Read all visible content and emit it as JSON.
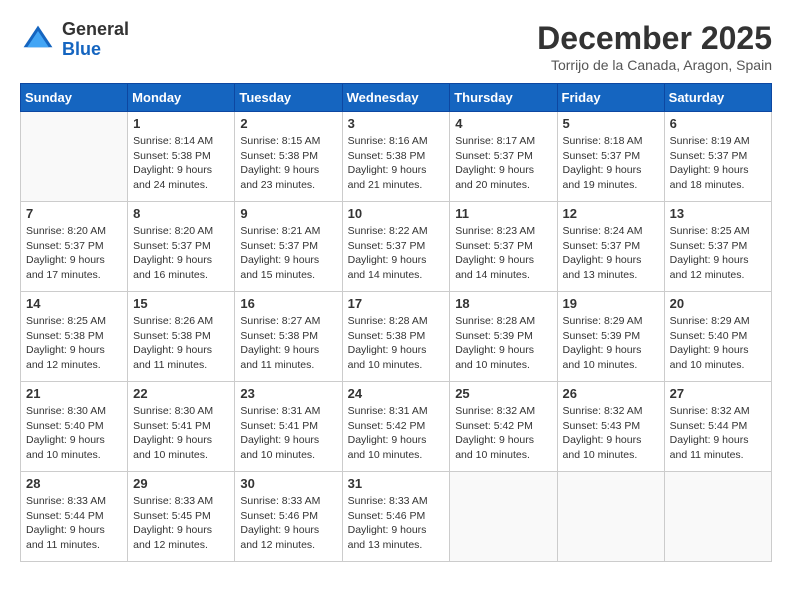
{
  "header": {
    "logo": {
      "general": "General",
      "blue": "Blue"
    },
    "title": "December 2025",
    "location": "Torrijo de la Canada, Aragon, Spain"
  },
  "weekdays": [
    "Sunday",
    "Monday",
    "Tuesday",
    "Wednesday",
    "Thursday",
    "Friday",
    "Saturday"
  ],
  "weeks": [
    [
      {
        "day": "",
        "sunrise": "",
        "sunset": "",
        "daylight": ""
      },
      {
        "day": "1",
        "sunrise": "Sunrise: 8:14 AM",
        "sunset": "Sunset: 5:38 PM",
        "daylight": "Daylight: 9 hours and 24 minutes."
      },
      {
        "day": "2",
        "sunrise": "Sunrise: 8:15 AM",
        "sunset": "Sunset: 5:38 PM",
        "daylight": "Daylight: 9 hours and 23 minutes."
      },
      {
        "day": "3",
        "sunrise": "Sunrise: 8:16 AM",
        "sunset": "Sunset: 5:38 PM",
        "daylight": "Daylight: 9 hours and 21 minutes."
      },
      {
        "day": "4",
        "sunrise": "Sunrise: 8:17 AM",
        "sunset": "Sunset: 5:37 PM",
        "daylight": "Daylight: 9 hours and 20 minutes."
      },
      {
        "day": "5",
        "sunrise": "Sunrise: 8:18 AM",
        "sunset": "Sunset: 5:37 PM",
        "daylight": "Daylight: 9 hours and 19 minutes."
      },
      {
        "day": "6",
        "sunrise": "Sunrise: 8:19 AM",
        "sunset": "Sunset: 5:37 PM",
        "daylight": "Daylight: 9 hours and 18 minutes."
      }
    ],
    [
      {
        "day": "7",
        "sunrise": "Sunrise: 8:20 AM",
        "sunset": "Sunset: 5:37 PM",
        "daylight": "Daylight: 9 hours and 17 minutes."
      },
      {
        "day": "8",
        "sunrise": "Sunrise: 8:20 AM",
        "sunset": "Sunset: 5:37 PM",
        "daylight": "Daylight: 9 hours and 16 minutes."
      },
      {
        "day": "9",
        "sunrise": "Sunrise: 8:21 AM",
        "sunset": "Sunset: 5:37 PM",
        "daylight": "Daylight: 9 hours and 15 minutes."
      },
      {
        "day": "10",
        "sunrise": "Sunrise: 8:22 AM",
        "sunset": "Sunset: 5:37 PM",
        "daylight": "Daylight: 9 hours and 14 minutes."
      },
      {
        "day": "11",
        "sunrise": "Sunrise: 8:23 AM",
        "sunset": "Sunset: 5:37 PM",
        "daylight": "Daylight: 9 hours and 14 minutes."
      },
      {
        "day": "12",
        "sunrise": "Sunrise: 8:24 AM",
        "sunset": "Sunset: 5:37 PM",
        "daylight": "Daylight: 9 hours and 13 minutes."
      },
      {
        "day": "13",
        "sunrise": "Sunrise: 8:25 AM",
        "sunset": "Sunset: 5:37 PM",
        "daylight": "Daylight: 9 hours and 12 minutes."
      }
    ],
    [
      {
        "day": "14",
        "sunrise": "Sunrise: 8:25 AM",
        "sunset": "Sunset: 5:38 PM",
        "daylight": "Daylight: 9 hours and 12 minutes."
      },
      {
        "day": "15",
        "sunrise": "Sunrise: 8:26 AM",
        "sunset": "Sunset: 5:38 PM",
        "daylight": "Daylight: 9 hours and 11 minutes."
      },
      {
        "day": "16",
        "sunrise": "Sunrise: 8:27 AM",
        "sunset": "Sunset: 5:38 PM",
        "daylight": "Daylight: 9 hours and 11 minutes."
      },
      {
        "day": "17",
        "sunrise": "Sunrise: 8:28 AM",
        "sunset": "Sunset: 5:38 PM",
        "daylight": "Daylight: 9 hours and 10 minutes."
      },
      {
        "day": "18",
        "sunrise": "Sunrise: 8:28 AM",
        "sunset": "Sunset: 5:39 PM",
        "daylight": "Daylight: 9 hours and 10 minutes."
      },
      {
        "day": "19",
        "sunrise": "Sunrise: 8:29 AM",
        "sunset": "Sunset: 5:39 PM",
        "daylight": "Daylight: 9 hours and 10 minutes."
      },
      {
        "day": "20",
        "sunrise": "Sunrise: 8:29 AM",
        "sunset": "Sunset: 5:40 PM",
        "daylight": "Daylight: 9 hours and 10 minutes."
      }
    ],
    [
      {
        "day": "21",
        "sunrise": "Sunrise: 8:30 AM",
        "sunset": "Sunset: 5:40 PM",
        "daylight": "Daylight: 9 hours and 10 minutes."
      },
      {
        "day": "22",
        "sunrise": "Sunrise: 8:30 AM",
        "sunset": "Sunset: 5:41 PM",
        "daylight": "Daylight: 9 hours and 10 minutes."
      },
      {
        "day": "23",
        "sunrise": "Sunrise: 8:31 AM",
        "sunset": "Sunset: 5:41 PM",
        "daylight": "Daylight: 9 hours and 10 minutes."
      },
      {
        "day": "24",
        "sunrise": "Sunrise: 8:31 AM",
        "sunset": "Sunset: 5:42 PM",
        "daylight": "Daylight: 9 hours and 10 minutes."
      },
      {
        "day": "25",
        "sunrise": "Sunrise: 8:32 AM",
        "sunset": "Sunset: 5:42 PM",
        "daylight": "Daylight: 9 hours and 10 minutes."
      },
      {
        "day": "26",
        "sunrise": "Sunrise: 8:32 AM",
        "sunset": "Sunset: 5:43 PM",
        "daylight": "Daylight: 9 hours and 10 minutes."
      },
      {
        "day": "27",
        "sunrise": "Sunrise: 8:32 AM",
        "sunset": "Sunset: 5:44 PM",
        "daylight": "Daylight: 9 hours and 11 minutes."
      }
    ],
    [
      {
        "day": "28",
        "sunrise": "Sunrise: 8:33 AM",
        "sunset": "Sunset: 5:44 PM",
        "daylight": "Daylight: 9 hours and 11 minutes."
      },
      {
        "day": "29",
        "sunrise": "Sunrise: 8:33 AM",
        "sunset": "Sunset: 5:45 PM",
        "daylight": "Daylight: 9 hours and 12 minutes."
      },
      {
        "day": "30",
        "sunrise": "Sunrise: 8:33 AM",
        "sunset": "Sunset: 5:46 PM",
        "daylight": "Daylight: 9 hours and 12 minutes."
      },
      {
        "day": "31",
        "sunrise": "Sunrise: 8:33 AM",
        "sunset": "Sunset: 5:46 PM",
        "daylight": "Daylight: 9 hours and 13 minutes."
      },
      {
        "day": "",
        "sunrise": "",
        "sunset": "",
        "daylight": ""
      },
      {
        "day": "",
        "sunrise": "",
        "sunset": "",
        "daylight": ""
      },
      {
        "day": "",
        "sunrise": "",
        "sunset": "",
        "daylight": ""
      }
    ]
  ]
}
